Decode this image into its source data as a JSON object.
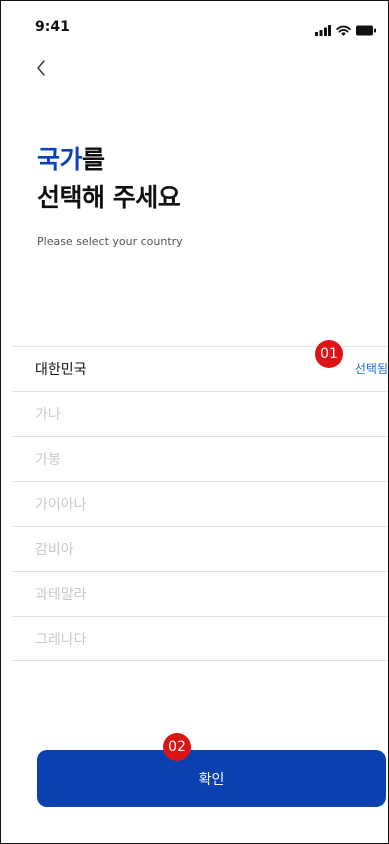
{
  "status_bar": {
    "time": "9:41",
    "icons": [
      "signal-icon",
      "wifi-icon",
      "battery-icon"
    ]
  },
  "nav": {
    "back_icon": "chevron-left-icon"
  },
  "header": {
    "title_accent": "국가",
    "title_rest_line1": "를",
    "title_line2": "선택해 주세요",
    "subtitle": "Please select your country"
  },
  "countries": [
    {
      "name": "대한민국",
      "selected": true,
      "selected_label": "선택됨"
    },
    {
      "name": "가나",
      "selected": false
    },
    {
      "name": "가봉",
      "selected": false
    },
    {
      "name": "가이아나",
      "selected": false
    },
    {
      "name": "감비아",
      "selected": false
    },
    {
      "name": "과테말라",
      "selected": false
    },
    {
      "name": "그레나다",
      "selected": false
    }
  ],
  "annotations": {
    "marker_1": "01",
    "marker_2": "02"
  },
  "footer": {
    "confirm_label": "확인"
  },
  "colors": {
    "accent": "#0a44b8",
    "button": "#0a40b0",
    "selected_text": "#1e6fd9",
    "marker": "#dd1414",
    "inactive_text": "#c9c9c9"
  }
}
